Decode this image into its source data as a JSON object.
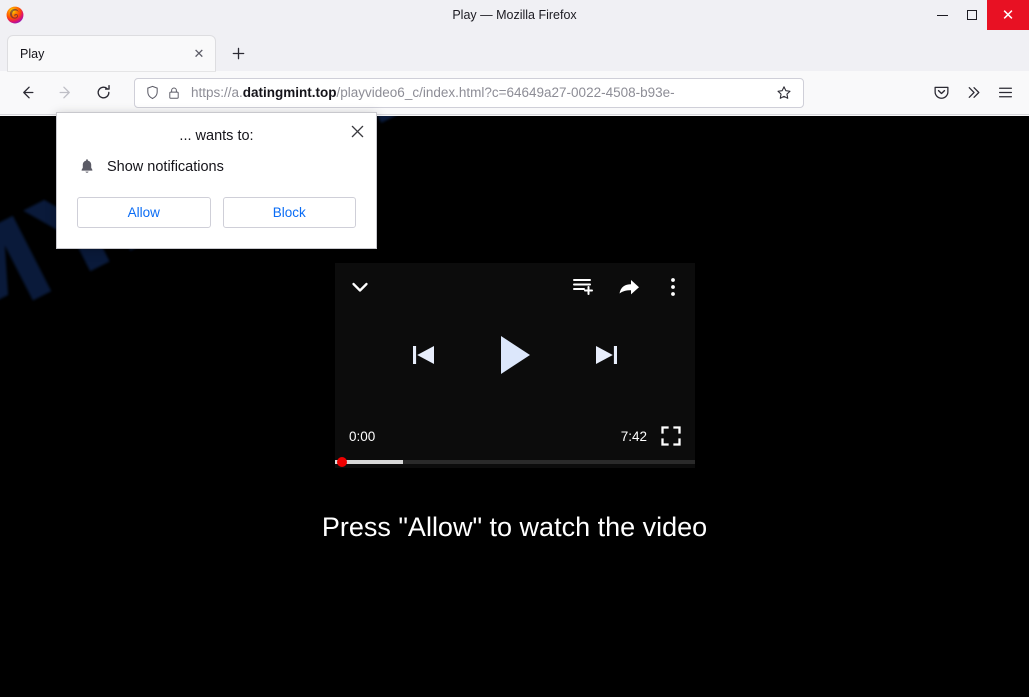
{
  "window": {
    "title": "Play — Mozilla Firefox",
    "controls": {
      "minimize": "Minimize",
      "maximize": "Maximize",
      "close": "✕"
    },
    "close_color": "#e81123"
  },
  "tabbar": {
    "tabs": [
      {
        "label": "Play",
        "close_glyph": "✕"
      }
    ],
    "new_tab_glyph": "＋"
  },
  "navbar": {
    "back": "←",
    "forward": "→",
    "reload": "⟳",
    "url": {
      "scheme": "https://a.",
      "domain": "datingmint.top",
      "path": "/playvideo6_c/index.html?c=64649a27-0022-4508-b93e-",
      "full": "https://a.datingmint.top/playvideo6_c/index.html?c=64649a27-0022-4508-b93e-"
    },
    "bookmark": "☆",
    "pocket": "pocket-icon",
    "overflow": "»",
    "menu": "≡"
  },
  "permission_popup": {
    "close_glyph": "✕",
    "heading": "... wants to:",
    "request_label": "Show notifications",
    "request_icon": "bell-icon",
    "allow_label": "Allow",
    "block_label": "Block",
    "button_color": "#0a6cf5"
  },
  "page": {
    "background": "#000000",
    "watermark": "MYANTISPYWARE.COM",
    "watermark_color": "#0b1c3e",
    "cta": "Press \"Allow\" to watch the video",
    "player": {
      "collapse_icon": "chevron-down-icon",
      "queue_icon": "add-to-queue-icon",
      "share_icon": "share-icon",
      "more_icon": "kebab-menu-icon",
      "previous_icon": "skip-previous-icon",
      "play_icon": "play-icon",
      "next_icon": "skip-next-icon",
      "current_time": "0:00",
      "duration": "7:42",
      "fullscreen_icon": "fullscreen-icon",
      "progress_percent": 19,
      "progress_dot_color": "#ee0000"
    }
  }
}
